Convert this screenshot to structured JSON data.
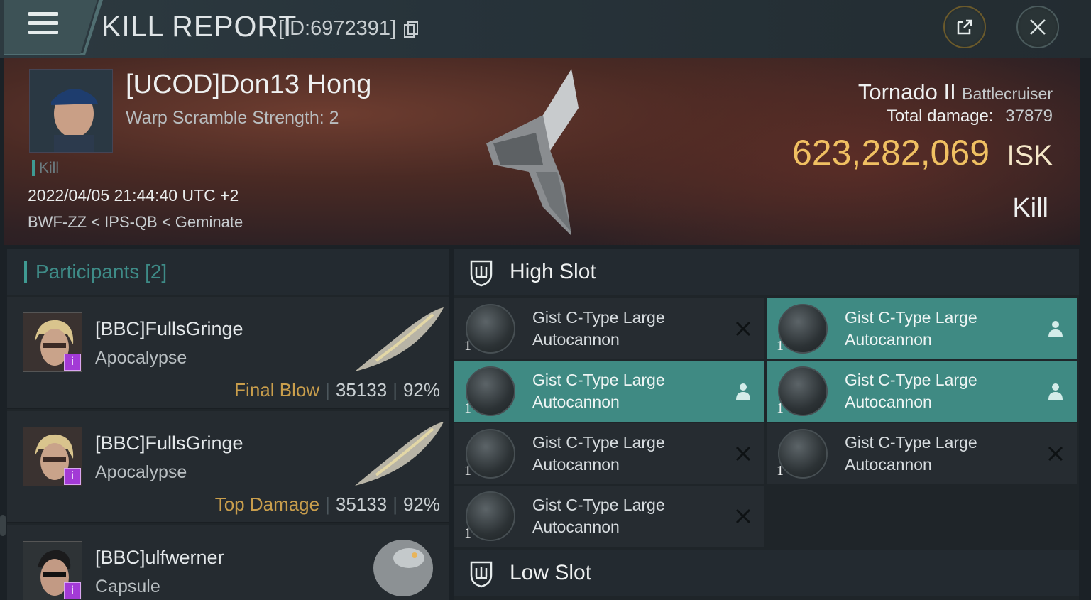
{
  "header": {
    "title": "KILL REPORT",
    "report_id": "[ID:6972391]",
    "menu_icon": "hamburger-icon",
    "share_icon": "share-icon",
    "close_icon": "close-icon"
  },
  "victim": {
    "name": "[UCOD]Don13 Hong",
    "subtitle": "Warp Scramble Strength: 2",
    "tag": "Kill",
    "datetime": "2022/04/05 21:44:40 UTC +2",
    "location": "BWF-ZZ < IPS-QB < Geminate",
    "ship_name": "Tornado II",
    "ship_class": "Battlecruiser",
    "damage_label": "Total damage:",
    "damage_value": "37879",
    "isk_value": "623,282,069",
    "isk_unit": "ISK",
    "result": "Kill"
  },
  "participants": {
    "title": "Participants [2]",
    "rows": [
      {
        "name": "[BBC]FullsGringe",
        "ship": "Apocalypse",
        "stat_label": "Final Blow",
        "damage": "35133",
        "percent": "92%",
        "badge": "i"
      },
      {
        "name": "[BBC]FullsGringe",
        "ship": "Apocalypse",
        "stat_label": "Top Damage",
        "damage": "35133",
        "percent": "92%",
        "badge": "i"
      },
      {
        "name": "[BBC]ulfwerner",
        "ship": "Capsule",
        "badge": "i"
      }
    ]
  },
  "fitting": {
    "high_slot_title": "High Slot",
    "low_slot_title": "Low Slot",
    "modules": [
      {
        "line1": "Gist C-Type Large",
        "line2": "Autocannon",
        "qty": "1",
        "status": "destroyed"
      },
      {
        "line1": "Gist C-Type Large",
        "line2": "Autocannon",
        "qty": "1",
        "status": "dropped"
      },
      {
        "line1": "Gist C-Type Large",
        "line2": "Autocannon",
        "qty": "1",
        "status": "dropped"
      },
      {
        "line1": "Gist C-Type Large",
        "line2": "Autocannon",
        "qty": "1",
        "status": "dropped"
      },
      {
        "line1": "Gist C-Type Large",
        "line2": "Autocannon",
        "qty": "1",
        "status": "destroyed"
      },
      {
        "line1": "Gist C-Type Large",
        "line2": "Autocannon",
        "qty": "1",
        "status": "destroyed"
      },
      {
        "line1": "Gist C-Type Large",
        "line2": "Autocannon",
        "qty": "1",
        "status": "destroyed"
      }
    ]
  },
  "colors": {
    "accent_teal": "#3f8a83",
    "isk_gold": "#f0c062",
    "stat_label_gold": "#c99e4c",
    "badge_purple": "#a33ad6"
  }
}
